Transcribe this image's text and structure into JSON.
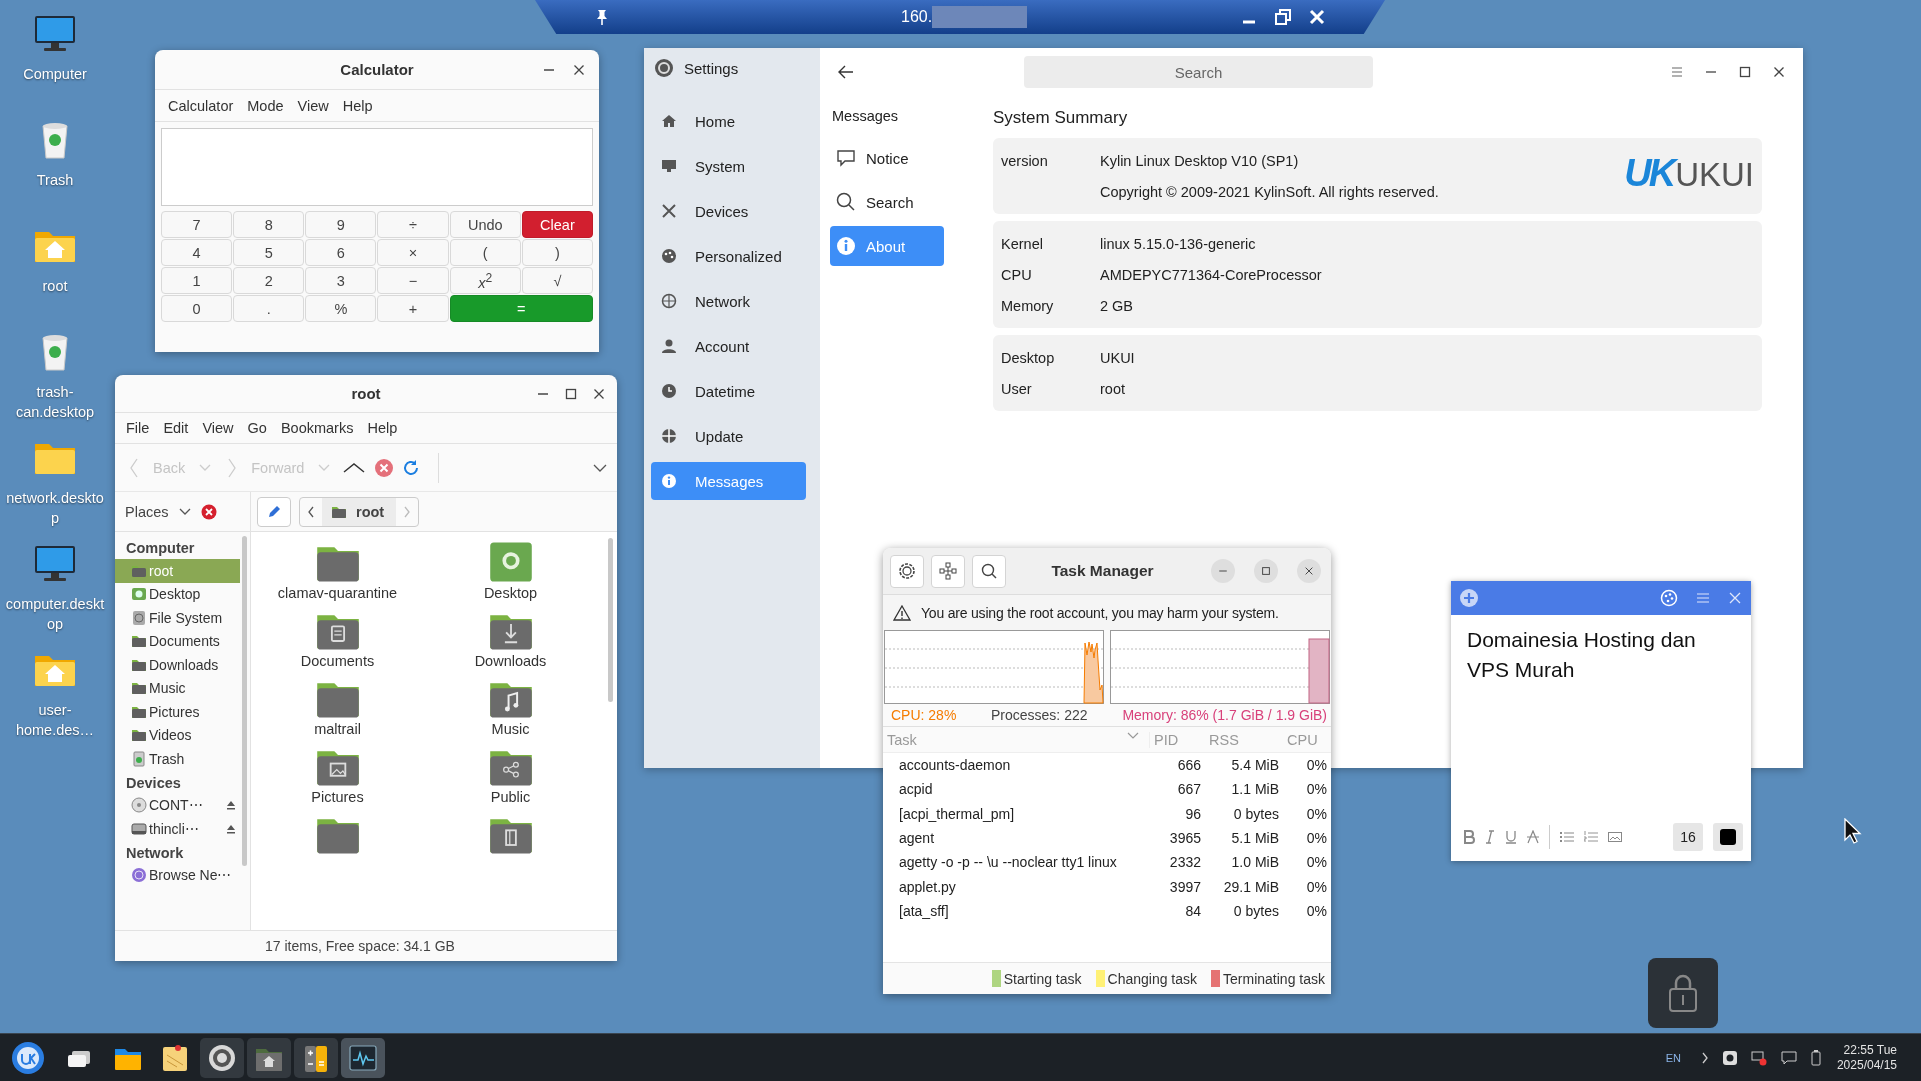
{
  "desktop_icons": [
    {
      "label": "Computer",
      "kind": "computer"
    },
    {
      "label": "Trash",
      "kind": "trash"
    },
    {
      "label": "root",
      "kind": "home"
    },
    {
      "label": "trash-can.desktop",
      "kind": "trash"
    },
    {
      "label": "network.desktop",
      "kind": "folder"
    },
    {
      "label": "computer.desktop",
      "kind": "computer"
    },
    {
      "label": "user-home.des…",
      "kind": "home"
    }
  ],
  "remote_bar": {
    "title": "160."
  },
  "calculator": {
    "title": "Calculator",
    "menu": [
      "Calculator",
      "Mode",
      "View",
      "Help"
    ],
    "keys": [
      {
        "label": "7",
        "kind": "normal"
      },
      {
        "label": "8",
        "kind": "normal"
      },
      {
        "label": "9",
        "kind": "normal"
      },
      {
        "label": "÷",
        "kind": "normal"
      },
      {
        "label": "Undo",
        "kind": "normal"
      },
      {
        "label": "Clear",
        "kind": "clear"
      },
      {
        "label": "4",
        "kind": "normal"
      },
      {
        "label": "5",
        "kind": "normal"
      },
      {
        "label": "6",
        "kind": "normal"
      },
      {
        "label": "×",
        "kind": "normal"
      },
      {
        "label": "(",
        "kind": "normal"
      },
      {
        "label": ")",
        "kind": "normal"
      },
      {
        "label": "1",
        "kind": "normal"
      },
      {
        "label": "2",
        "kind": "normal"
      },
      {
        "label": "3",
        "kind": "normal"
      },
      {
        "label": "−",
        "kind": "normal"
      },
      {
        "label": "*x*$^{2}$",
        "kind": "normal"
      },
      {
        "label": "√",
        "kind": "normal"
      },
      {
        "label": "0",
        "kind": "normal"
      },
      {
        "label": ".",
        "kind": "normal"
      },
      {
        "label": "%",
        "kind": "normal"
      },
      {
        "label": "+",
        "kind": "normal"
      },
      {
        "label": "=",
        "kind": "equals"
      }
    ]
  },
  "file_manager": {
    "title": "root",
    "menu": [
      "File",
      "Edit",
      "View",
      "Go",
      "Bookmarks",
      "Help"
    ],
    "toolbar": [
      {
        "label": "Back",
        "disabled": true
      },
      {
        "label": "Forward",
        "disabled": true
      }
    ],
    "places_label": "Places",
    "path": "root",
    "sidebar": [
      {
        "heading": "Computer",
        "items": [
          {
            "label": "root",
            "kind": "folder",
            "selected": true
          },
          {
            "label": "Desktop",
            "kind": "desktop",
            "selected": false
          },
          {
            "label": "File System",
            "kind": "filesystem",
            "selected": false
          },
          {
            "label": "Documents",
            "kind": "folder",
            "selected": false
          },
          {
            "label": "Downloads",
            "kind": "folder",
            "selected": false
          },
          {
            "label": "Music",
            "kind": "folder",
            "selected": false
          },
          {
            "label": "Pictures",
            "kind": "folder",
            "selected": false
          },
          {
            "label": "Videos",
            "kind": "folder",
            "selected": false
          },
          {
            "label": "Trash",
            "kind": "trash",
            "selected": false
          }
        ]
      },
      {
        "heading": "Devices",
        "items": [
          {
            "label": "CONT⋯",
            "kind": "disc",
            "selected": false
          },
          {
            "label": "thincli⋯",
            "kind": "drive",
            "selected": false
          }
        ]
      },
      {
        "heading": "Network",
        "items": [
          {
            "label": "Browse Ne⋯",
            "kind": "network",
            "selected": false
          }
        ]
      }
    ],
    "items": [
      {
        "label": "clamav-quarantine",
        "kind": "plain"
      },
      {
        "label": "Desktop",
        "kind": "desktop"
      },
      {
        "label": "Documents",
        "kind": "documents"
      },
      {
        "label": "Downloads",
        "kind": "downloads"
      },
      {
        "label": "maltrail",
        "kind": "plain"
      },
      {
        "label": "Music",
        "kind": "music"
      },
      {
        "label": "Pictures",
        "kind": "pictures"
      },
      {
        "label": "Public",
        "kind": "public"
      },
      {
        "kind": "plain"
      },
      {
        "kind": "templates"
      }
    ],
    "status": "17 items, Free space: 34.1 GB"
  },
  "settings": {
    "title": "Settings",
    "search": {
      "placeholder": "Search"
    },
    "nav": [
      {
        "label": "Home",
        "kind": "home",
        "selected": false
      },
      {
        "label": "System",
        "kind": "system",
        "selected": false
      },
      {
        "label": "Devices",
        "kind": "devices",
        "selected": false
      },
      {
        "label": "Personalized",
        "kind": "personalized",
        "selected": false
      },
      {
        "label": "Network",
        "kind": "network",
        "selected": false
      },
      {
        "label": "Account",
        "kind": "account",
        "selected": false
      },
      {
        "label": "Datetime",
        "kind": "datetime",
        "selected": false
      },
      {
        "label": "Update",
        "kind": "update",
        "selected": false
      },
      {
        "label": "Messages",
        "kind": "messages",
        "selected": true
      }
    ],
    "subnav_heading": "Messages",
    "subnav": [
      {
        "label": "Notice",
        "kind": "notice",
        "selected": false
      },
      {
        "label": "Search",
        "kind": "search",
        "selected": false
      },
      {
        "label": "About",
        "kind": "about",
        "selected": true
      }
    ],
    "heading": "System Summary",
    "groups": [
      {
        "rows": [
          {
            "key": "version",
            "value": "Kylin Linux Desktop V10 (SP1)"
          },
          {
            "value": "Copyright © 2009-2021 KylinSoft. All rights reserved."
          }
        ],
        "logo": {
          "mark": "UK",
          "text": "UKUI"
        }
      },
      {
        "rows": [
          {
            "key": "Kernel",
            "value": "linux 5.15.0-136-generic"
          },
          {
            "key": "CPU",
            "value": "AMDEPYC771364-CoreProcessor"
          },
          {
            "key": "Memory",
            "value": "2 GB"
          }
        ]
      },
      {
        "rows": [
          {
            "key": "Desktop",
            "value": "UKUI"
          },
          {
            "key": "User",
            "value": "root"
          }
        ]
      }
    ]
  },
  "task_manager": {
    "title": "Task Manager",
    "warning": "You are using the root account, you may harm your system.",
    "cpu": "CPU: 28%",
    "processes": "Processes: 222",
    "memory": "Memory: 86% (1.7 GiB / 1.9 GiB)",
    "columns": [
      "Task",
      "PID",
      "RSS",
      "CPU"
    ],
    "rows": [
      [
        "accounts-daemon",
        "666",
        "5.4 MiB",
        "0%"
      ],
      [
        "acpid",
        "667",
        "1.1 MiB",
        "0%"
      ],
      [
        "[acpi_thermal_pm]",
        "96",
        "0 bytes",
        "0%"
      ],
      [
        "agent",
        "3965",
        "5.1 MiB",
        "0%"
      ],
      [
        "agetty -o -p -- \\u --noclear tty1 linux",
        "2332",
        "1.0 MiB",
        "0%"
      ],
      [
        "applet.py",
        "3997",
        "29.1 MiB",
        "0%"
      ],
      [
        "[ata_sff]",
        "84",
        "0 bytes",
        "0%"
      ]
    ],
    "legend": [
      {
        "label": "Starting task",
        "color": "#aed581"
      },
      {
        "label": "Changing task",
        "color": "#fff176"
      },
      {
        "label": "Terminating task",
        "color": "#e57373"
      }
    ]
  },
  "note": {
    "text": "Domainesia Hosting dan VPS Murah",
    "font_size": "16"
  },
  "taskbar": {
    "apps": [
      {
        "kind": "multitask",
        "open": false,
        "focused": false
      },
      {
        "kind": "files",
        "open": false,
        "focused": false
      },
      {
        "kind": "notes",
        "open": false,
        "focused": false
      },
      {
        "kind": "settings",
        "open": true,
        "focused": false
      },
      {
        "kind": "home-folder",
        "open": true,
        "focused": false
      },
      {
        "kind": "calculator",
        "open": true,
        "focused": false
      },
      {
        "kind": "monitor",
        "open": true,
        "focused": true
      }
    ],
    "language": "EN",
    "time": "22:55 Tue",
    "date": "2025/04/15"
  }
}
